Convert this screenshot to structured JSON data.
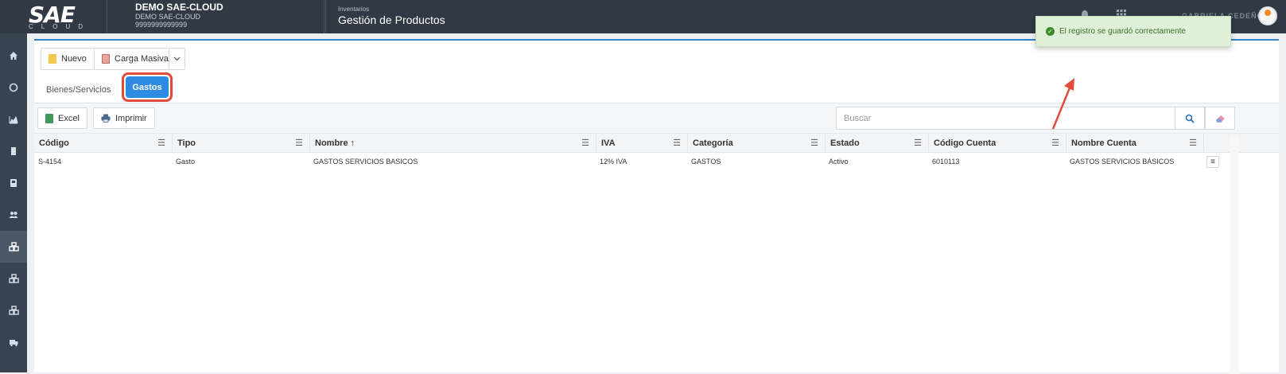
{
  "header": {
    "logo_text": "SAE",
    "logo_sub": "CLOUD",
    "company_name": "DEMO SAE-CLOUD",
    "company_sub": "DEMO SAE-CLOUD",
    "company_id": "9999999999999",
    "breadcrumb_module": "Inventarios",
    "page_title": "Gestión de Productos",
    "user_name": "GABRIELA CEDEÑO"
  },
  "sidebar": {
    "items": [
      {
        "icon": "home-icon"
      },
      {
        "icon": "circle-icon"
      },
      {
        "icon": "chart-icon"
      },
      {
        "icon": "building-icon"
      },
      {
        "icon": "book-icon"
      },
      {
        "icon": "users-icon"
      },
      {
        "icon": "cubes-icon",
        "active": true
      },
      {
        "icon": "cubes-icon"
      },
      {
        "icon": "cubes-icon"
      },
      {
        "icon": "truck-icon"
      }
    ]
  },
  "actions": {
    "new_label": "Nuevo",
    "bulk_label": "Carga Masiva"
  },
  "tabs": [
    {
      "label": "Bienes/Servicios"
    },
    {
      "label": "Gastos",
      "active": true
    }
  ],
  "toolbar": {
    "excel_label": "Excel",
    "print_label": "Imprimir",
    "search_placeholder": "Buscar"
  },
  "table": {
    "columns": [
      "Código",
      "Tipo",
      "Nombre ↑",
      "IVA",
      "Categoría",
      "Estado",
      "Código Cuenta",
      "Nombre Cuenta"
    ],
    "rows": [
      [
        "S-4154",
        "Gasto",
        "GASTOS SERVICIOS BASICOS",
        "12% IVA",
        "GASTOS",
        "Activo",
        "6010113",
        "GASTOS SERVICIOS BÁSICOS"
      ]
    ]
  },
  "toast": {
    "message": "El registro se guardó correctamente",
    "color": "#dff0d8"
  },
  "colors": {
    "accent": "#2f8ae2",
    "highlight": "#e04b3a",
    "topbar": "#313a44"
  }
}
